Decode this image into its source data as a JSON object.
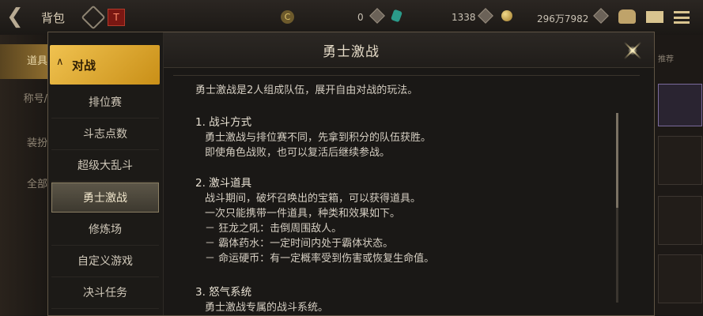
{
  "topbar": {
    "title": "背包",
    "red_badge": "T",
    "coin_symbol": "C",
    "currencies": [
      "0",
      "1338",
      "296万7982"
    ]
  },
  "bg_left_tabs": [
    "道具",
    "称号/",
    "装扮",
    "全部"
  ],
  "bg_right_label": "推荐",
  "modal": {
    "title": "勇士激战",
    "nav": {
      "group": "对战",
      "items": [
        "排位赛",
        "斗志点数",
        "超级大乱斗",
        "勇士激战",
        "修炼场",
        "自定义游戏",
        "决斗任务"
      ],
      "active_index": 3
    },
    "content": {
      "intro": "勇士激战是2人组成队伍，展开自由对战的玩法。",
      "sections": [
        {
          "heading": "1. 战斗方式",
          "lines": [
            "勇士激战与排位赛不同，先拿到积分的队伍获胜。",
            "即使角色战败，也可以复活后继续参战。"
          ]
        },
        {
          "heading": "2. 激斗道具",
          "lines": [
            "战斗期间，破坏召唤出的宝箱，可以获得道具。",
            "一次只能携带一件道具，种类和效果如下。",
            "－ 狂龙之吼：击倒周围敌人。",
            "－ 霸体药水：一定时间内处于霸体状态。",
            "－ 命运硬币：有一定概率受到伤害或恢复生命值。"
          ]
        },
        {
          "heading": "3. 怒气系统",
          "lines": [
            "勇士激战专属的战斗系统。"
          ]
        }
      ]
    }
  },
  "colors": {
    "accent_gold": "#e8b33a",
    "panel_bg": "#1a1816"
  }
}
